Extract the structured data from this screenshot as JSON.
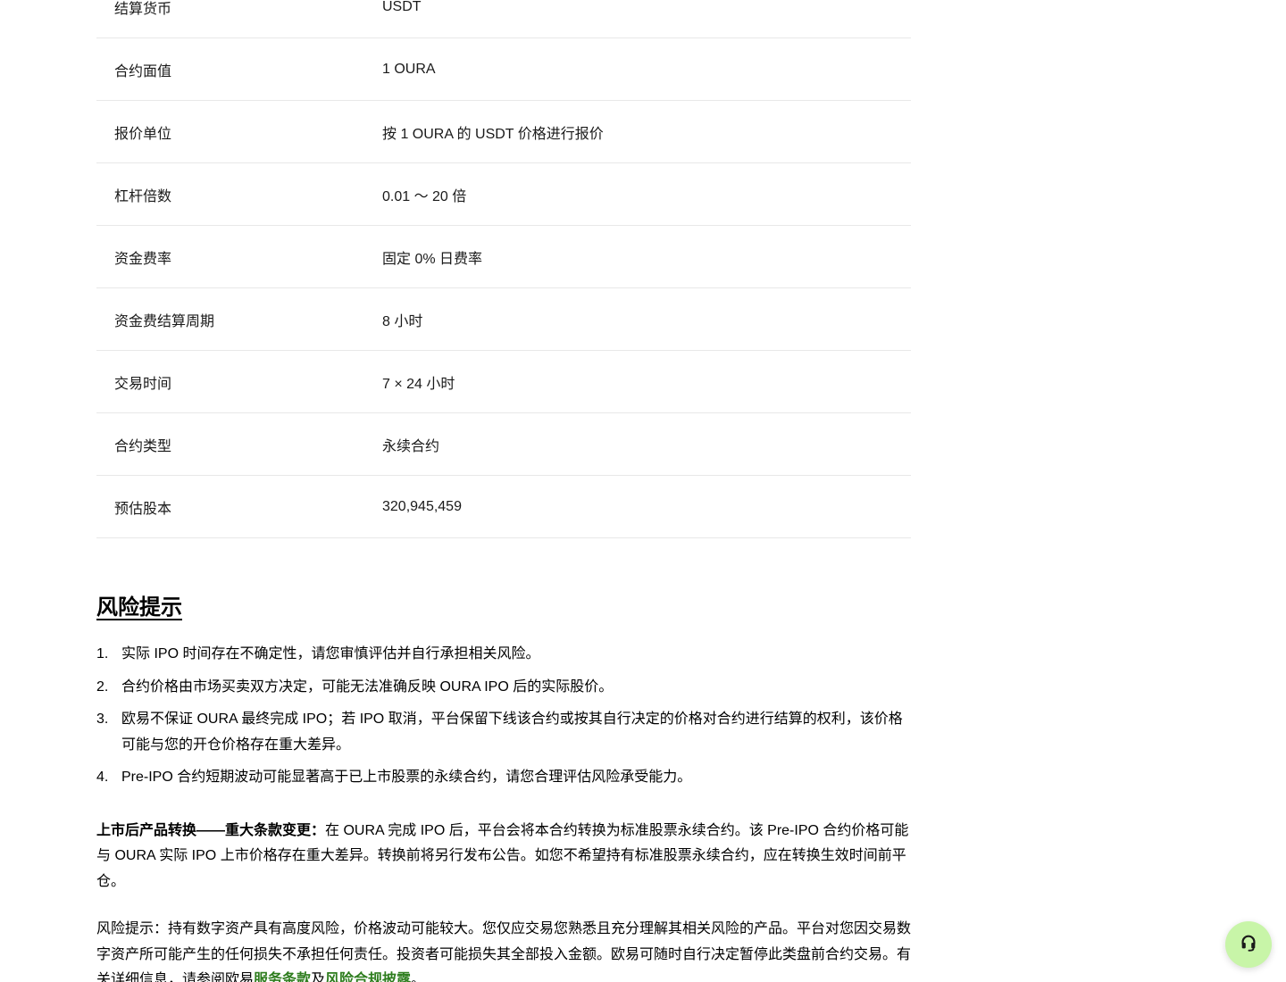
{
  "spec_table": {
    "rows": [
      {
        "label": "结算货币",
        "value": "USDT"
      },
      {
        "label": "合约面值",
        "value": "1 OURA"
      },
      {
        "label": "报价单位",
        "value": "按 1 OURA 的 USDT 价格进行报价"
      },
      {
        "label": "杠杆倍数",
        "value": "0.01 〜 20 倍"
      },
      {
        "label": "资金费率",
        "value": "固定 0% 日费率"
      },
      {
        "label": "资金费结算周期",
        "value": "8 小时"
      },
      {
        "label": "交易时间",
        "value": "7 × 24 小时"
      },
      {
        "label": "合约类型",
        "value": "永续合约"
      },
      {
        "label": "预估股本",
        "value": "320,945,459"
      }
    ]
  },
  "risk": {
    "title": "风险提示",
    "items": [
      {
        "num": "1.",
        "text": "实际 IPO 时间存在不确定性，请您审慎评估并自行承担相关风险。"
      },
      {
        "num": "2.",
        "text": "合约价格由市场买卖双方决定，可能无法准确反映 OURA IPO 后的实际股价。"
      },
      {
        "num": "3.",
        "text": "欧易不保证 OURA 最终完成 IPO；若 IPO 取消，平台保留下线该合约或按其自行决定的价格对合约进行结算的权利，该价格可能与您的开仓价格存在重大差异。"
      },
      {
        "num": "4.",
        "text": "Pre-IPO 合约短期波动可能显著高于已上市股票的永续合约，请您合理评估风险承受能力。"
      }
    ]
  },
  "conversion": {
    "heading": "上市后产品转换——重大条款变更：",
    "text": "在 OURA 完成 IPO 后，平台会将本合约转换为标准股票永续合约。该 Pre-IPO 合约价格可能与 OURA 实际 IPO 上市价格存在重大差异。转换前将另行发布公告。如您不希望持有标准股票永续合约，应在转换生效时间前平仓。"
  },
  "disclaimer": {
    "text": "风险提示：持有数字资产具有高度风险，价格波动可能较大。您仅应交易您熟悉且充分理解其相关风险的产品。平台对您因交易数字资产所可能产生的任何损失不承担任何责任。投资者可能损失其全部投入金额。欧易可随时自行决定暂停此类盘前合约交易。有关详细信息，请参阅欧易",
    "link1": "服务条款",
    "joiner": "及",
    "link2": "风险合规披露",
    "end": "。"
  },
  "support": {
    "icon": "headset-icon",
    "color": "#c8f5a8"
  }
}
